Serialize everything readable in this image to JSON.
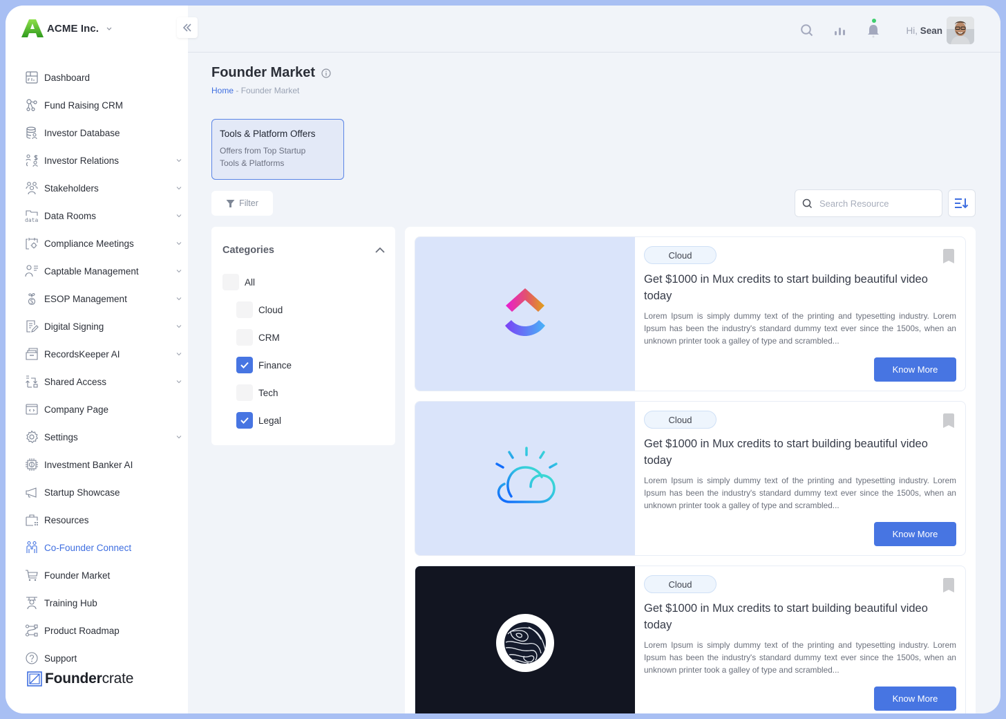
{
  "company": {
    "name": "ACME Inc."
  },
  "sidebar": {
    "items": [
      {
        "label": "Dashboard",
        "icon": "dashboard-icon",
        "chevron": false,
        "active": false
      },
      {
        "label": "Fund Raising CRM",
        "icon": "crm-icon",
        "chevron": false,
        "active": false
      },
      {
        "label": "Investor Database",
        "icon": "database-icon",
        "chevron": false,
        "active": false
      },
      {
        "label": "Investor Relations",
        "icon": "investor-relations-icon",
        "chevron": true,
        "active": false
      },
      {
        "label": "Stakeholders",
        "icon": "stakeholders-icon",
        "chevron": true,
        "active": false
      },
      {
        "label": "Data Rooms",
        "icon": "data-rooms-icon",
        "chevron": true,
        "active": false
      },
      {
        "label": "Compliance Meetings",
        "icon": "calendar-gear-icon",
        "chevron": true,
        "active": false
      },
      {
        "label": "Captable Management",
        "icon": "captable-icon",
        "chevron": true,
        "active": false
      },
      {
        "label": "ESOP Management",
        "icon": "esop-icon",
        "chevron": true,
        "active": false
      },
      {
        "label": "Digital Signing",
        "icon": "signing-icon",
        "chevron": true,
        "active": false
      },
      {
        "label": "RecordsKeeper AI",
        "icon": "records-icon",
        "chevron": true,
        "active": false
      },
      {
        "label": "Shared Access",
        "icon": "shared-access-icon",
        "chevron": true,
        "active": false
      },
      {
        "label": "Company Page",
        "icon": "company-page-icon",
        "chevron": false,
        "active": false
      },
      {
        "label": "Settings",
        "icon": "gear-icon",
        "chevron": true,
        "active": false
      },
      {
        "label": "Investment Banker AI",
        "icon": "chip-icon",
        "chevron": false,
        "active": false
      },
      {
        "label": "Startup Showcase",
        "icon": "megaphone-icon",
        "chevron": false,
        "active": false
      },
      {
        "label": "Resources",
        "icon": "briefcase-icon",
        "chevron": false,
        "active": false
      },
      {
        "label": "Co-Founder Connect",
        "icon": "cofounder-icon",
        "chevron": false,
        "active": true
      },
      {
        "label": "Founder Market",
        "icon": "cart-icon",
        "chevron": false,
        "active": false
      },
      {
        "label": "Training Hub",
        "icon": "training-icon",
        "chevron": false,
        "active": false
      },
      {
        "label": "Product Roadmap",
        "icon": "roadmap-icon",
        "chevron": false,
        "active": false
      },
      {
        "label": "Support",
        "icon": "help-icon",
        "chevron": false,
        "active": false
      }
    ],
    "footer_brand_bold": "Founder",
    "footer_brand_light": "crate"
  },
  "header": {
    "greeting_prefix": "Hi,",
    "user_name": "Sean",
    "notification_dot_color": "#3ecf6e"
  },
  "page": {
    "title": "Founder Market",
    "breadcrumb": {
      "home": "Home",
      "separator": " - ",
      "current": "Founder Market"
    },
    "tab": {
      "title": "Tools & Platform Offers",
      "subtitle": "Offers from Top Startup Tools & Platforms"
    },
    "filter_label": "Filter",
    "search_placeholder": "Search Resource"
  },
  "categories": {
    "heading": "Categories",
    "items": [
      {
        "label": "All",
        "checked": false,
        "indent": false
      },
      {
        "label": "Cloud",
        "checked": false,
        "indent": true
      },
      {
        "label": "CRM",
        "checked": false,
        "indent": true
      },
      {
        "label": "Finance",
        "checked": true,
        "indent": true
      },
      {
        "label": "Tech",
        "checked": false,
        "indent": true
      },
      {
        "label": "Legal",
        "checked": true,
        "indent": true
      }
    ]
  },
  "offers": [
    {
      "tag": "Cloud",
      "title": "Get $1000 in Mux credits to start building beautiful video today",
      "description": "Lorem Ipsum is simply dummy text of the printing and typesetting industry. Lorem Ipsum has been the industry's standard dummy text ever since the 1500s, when an unknown printer took a galley of type and scrambled...",
      "button": "Know More",
      "logo": "clickup-logo",
      "media_bg": "#dae4fa"
    },
    {
      "tag": "Cloud",
      "title": "Get $1000 in Mux credits to start building beautiful video today",
      "description": "Lorem Ipsum is simply dummy text of the printing and typesetting industry. Lorem Ipsum has been the industry's standard dummy text ever since the 1500s, when an unknown printer took a galley of type and scrambled...",
      "button": "Know More",
      "logo": "ibm-cloud-logo",
      "media_bg": "#dae4fa"
    },
    {
      "tag": "Cloud",
      "title": "Get $1000 in Mux credits to start building beautiful video today",
      "description": "Lorem Ipsum is simply dummy text of the printing and typesetting industry. Lorem Ipsum has been the industry's standard dummy text ever since the 1500s, when an unknown printer took a galley of type and scrambled...",
      "button": "Know More",
      "logo": "topography-logo",
      "media_bg": "#121521"
    }
  ],
  "colors": {
    "accent": "#4775e2",
    "active_nav": "#3e6ee0",
    "frame": "#a8bff3"
  }
}
